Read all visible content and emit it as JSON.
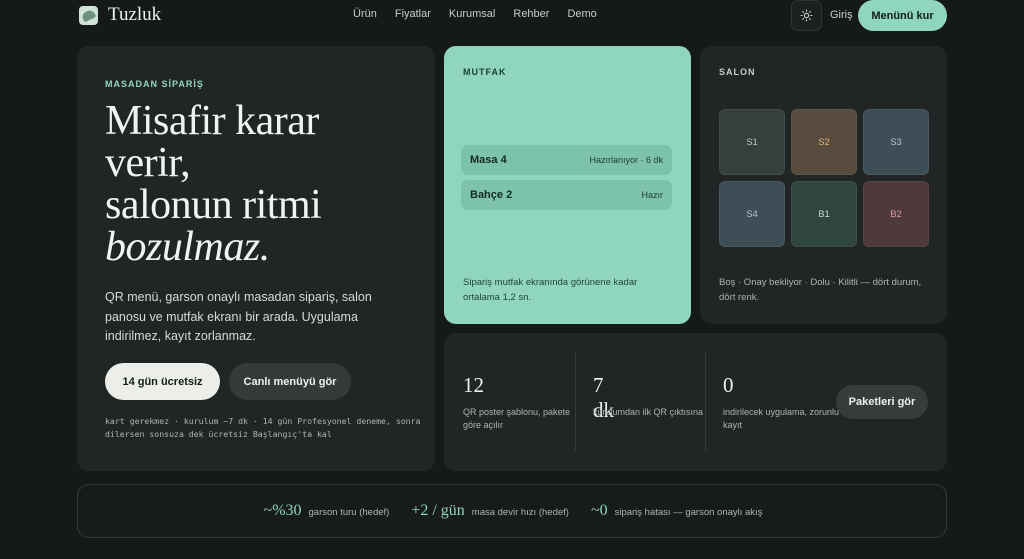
{
  "nav": {
    "brand": "Tuzluk",
    "links": [
      "Ürün",
      "Fiyatlar",
      "Kurumsal",
      "Rehber",
      "Demo"
    ],
    "login": "Giriş",
    "cta": "Menünü kur",
    "theme_icon": "sun-icon"
  },
  "hero": {
    "eyebrow": "MASADAN SİPARİŞ",
    "title_line1": "Misafir karar",
    "title_line2": "verir,",
    "title_line3": "salonun ritmi",
    "title_line4": "bozulmaz.",
    "description": "QR menü, garson onaylı masadan sipariş, salon panosu ve mutfak ekranı bir arada. Uygulama indirilmez, kayıt zorlanmaz.",
    "primary_button": "14 gün ücretsiz",
    "secondary_button": "Canlı menüyü gör",
    "note": "kart gerekmez · kurulum ~7 dk · 14 gün Profesyonel deneme, sonra dilersen sonsuza dek ücretsiz Başlangıç'ta kal"
  },
  "kitchen": {
    "eyebrow": "MUTFAK",
    "orders": [
      {
        "name": "Masa 4",
        "status": "Hazırlanıyor · 6 dk"
      },
      {
        "name": "Bahçe 2",
        "status": "Hazır"
      }
    ],
    "footer": "Sipariş mutfak ekranında görünene kadar ortalama 1,2 sn."
  },
  "salon": {
    "eyebrow": "SALON",
    "tables": [
      {
        "label": "S1",
        "state": "empty"
      },
      {
        "label": "S2",
        "state": "wait"
      },
      {
        "label": "S3",
        "state": "busy"
      },
      {
        "label": "S4",
        "state": "busy"
      },
      {
        "label": "B1",
        "state": "full"
      },
      {
        "label": "B2",
        "state": "lock"
      }
    ],
    "footer": "Boş · Onay bekliyor · Dolu · Kilitli — dört durum, dört renk."
  },
  "stats": {
    "items": [
      {
        "value": "12",
        "label": "QR poster şablonu, pakete göre açılır"
      },
      {
        "value": "7 dk",
        "label": "kurulumdan ilk QR çıktısına"
      },
      {
        "value": "0",
        "label": "indirilecek uygulama, zorunlu kayıt"
      }
    ],
    "button": "Paketleri gör"
  },
  "kpis": [
    {
      "value": "~%30",
      "label": "garson turu (hedef)"
    },
    {
      "value": "+2 / gün",
      "label": "masa devir hızı (hedef)"
    },
    {
      "value": "~0",
      "label": "sipariş hatası — garson onaylı akış"
    }
  ]
}
